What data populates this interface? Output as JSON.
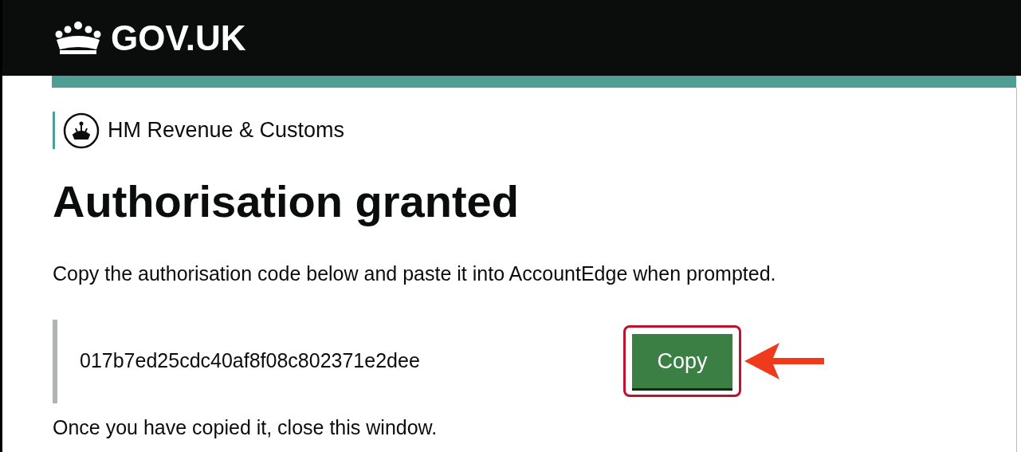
{
  "header": {
    "logo_text": "GOV.UK"
  },
  "department": {
    "name": "HM Revenue & Customs"
  },
  "heading": "Authorisation granted",
  "instruction": "Copy the authorisation code below and paste it into AccountEdge when prompted.",
  "code": {
    "value": "017b7ed25cdc40af8f08c802371e2dee",
    "button": "Copy"
  },
  "footer_text": "Once you have copied it, close this window."
}
